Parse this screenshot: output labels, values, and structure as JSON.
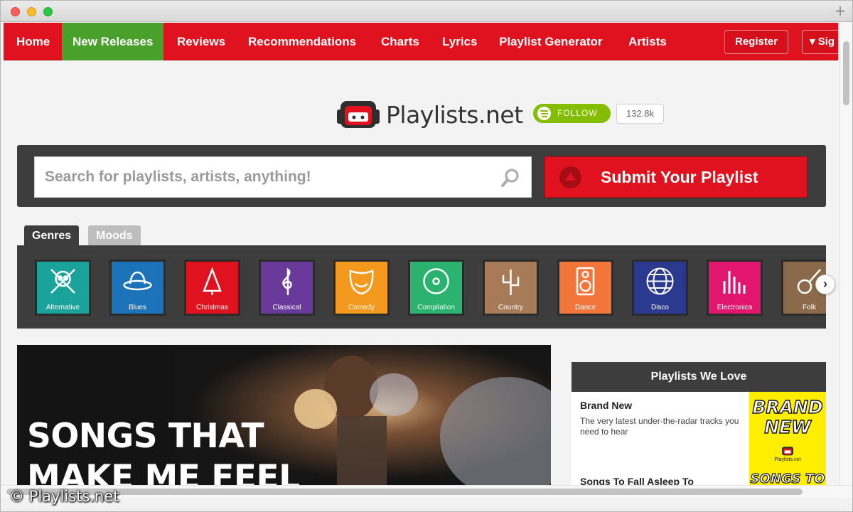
{
  "nav": {
    "items": [
      {
        "label": "Home"
      },
      {
        "label": "New Releases",
        "active": true
      },
      {
        "label": "Reviews"
      },
      {
        "label": "Recommendations"
      },
      {
        "label": "Charts"
      },
      {
        "label": "Lyrics"
      },
      {
        "label": "Playlist Generator"
      },
      {
        "label": "Artists"
      }
    ],
    "register_label": "Register",
    "signin_label": "▾ Sig"
  },
  "brand": {
    "logo_text": "Playlists.net",
    "follow_label": "FOLLOW",
    "follower_count": "132.8k"
  },
  "search": {
    "placeholder": "Search for playlists, artists, anything!",
    "submit_label": "Submit Your Playlist"
  },
  "tabs": [
    {
      "label": "Genres",
      "active": true
    },
    {
      "label": "Moods",
      "active": false
    }
  ],
  "genres": [
    {
      "label": "Alternative",
      "color": "#1aa39a",
      "icon": "skull-crossbones-icon"
    },
    {
      "label": "Blues",
      "color": "#1c73b9",
      "icon": "hat-icon"
    },
    {
      "label": "Christmas",
      "color": "#e0121f",
      "icon": "christmas-tree-icon"
    },
    {
      "label": "Classical",
      "color": "#6a3a9a",
      "icon": "treble-clef-icon"
    },
    {
      "label": "Comedy",
      "color": "#f39a1e",
      "icon": "theatre-mask-icon"
    },
    {
      "label": "Compilation",
      "color": "#2bb26f",
      "icon": "disc-icon"
    },
    {
      "label": "Country",
      "color": "#a77b58",
      "icon": "cactus-icon"
    },
    {
      "label": "Dance",
      "color": "#f2763a",
      "icon": "speaker-icon"
    },
    {
      "label": "Disco",
      "color": "#2b3a8e",
      "icon": "disco-ball-icon"
    },
    {
      "label": "Electronica",
      "color": "#e3166f",
      "icon": "equalizer-icon"
    },
    {
      "label": "Folk",
      "color": "#8a6a4a",
      "icon": "guitar-icon"
    }
  ],
  "feature": {
    "title_line1": "SONGS THAT",
    "title_line2": "MAKE ME FEEL"
  },
  "playlists_we_love": {
    "heading": "Playlists We Love",
    "items": [
      {
        "title": "Brand New",
        "description": "The very latest under-the-radar tracks you need to hear",
        "thumb_line1": "BRAND",
        "thumb_line2": "NEW",
        "thumb_site": "Playlists.net"
      },
      {
        "title": "Songs To Fall Asleep To",
        "thumb_text": "SONGS TO"
      }
    ]
  },
  "watermark": "© Playlists.net",
  "colors": {
    "brand_red": "#e0121f",
    "active_green": "#49a02a",
    "dark_panel": "#3d3d3d",
    "spotify_green": "#84bd00"
  }
}
